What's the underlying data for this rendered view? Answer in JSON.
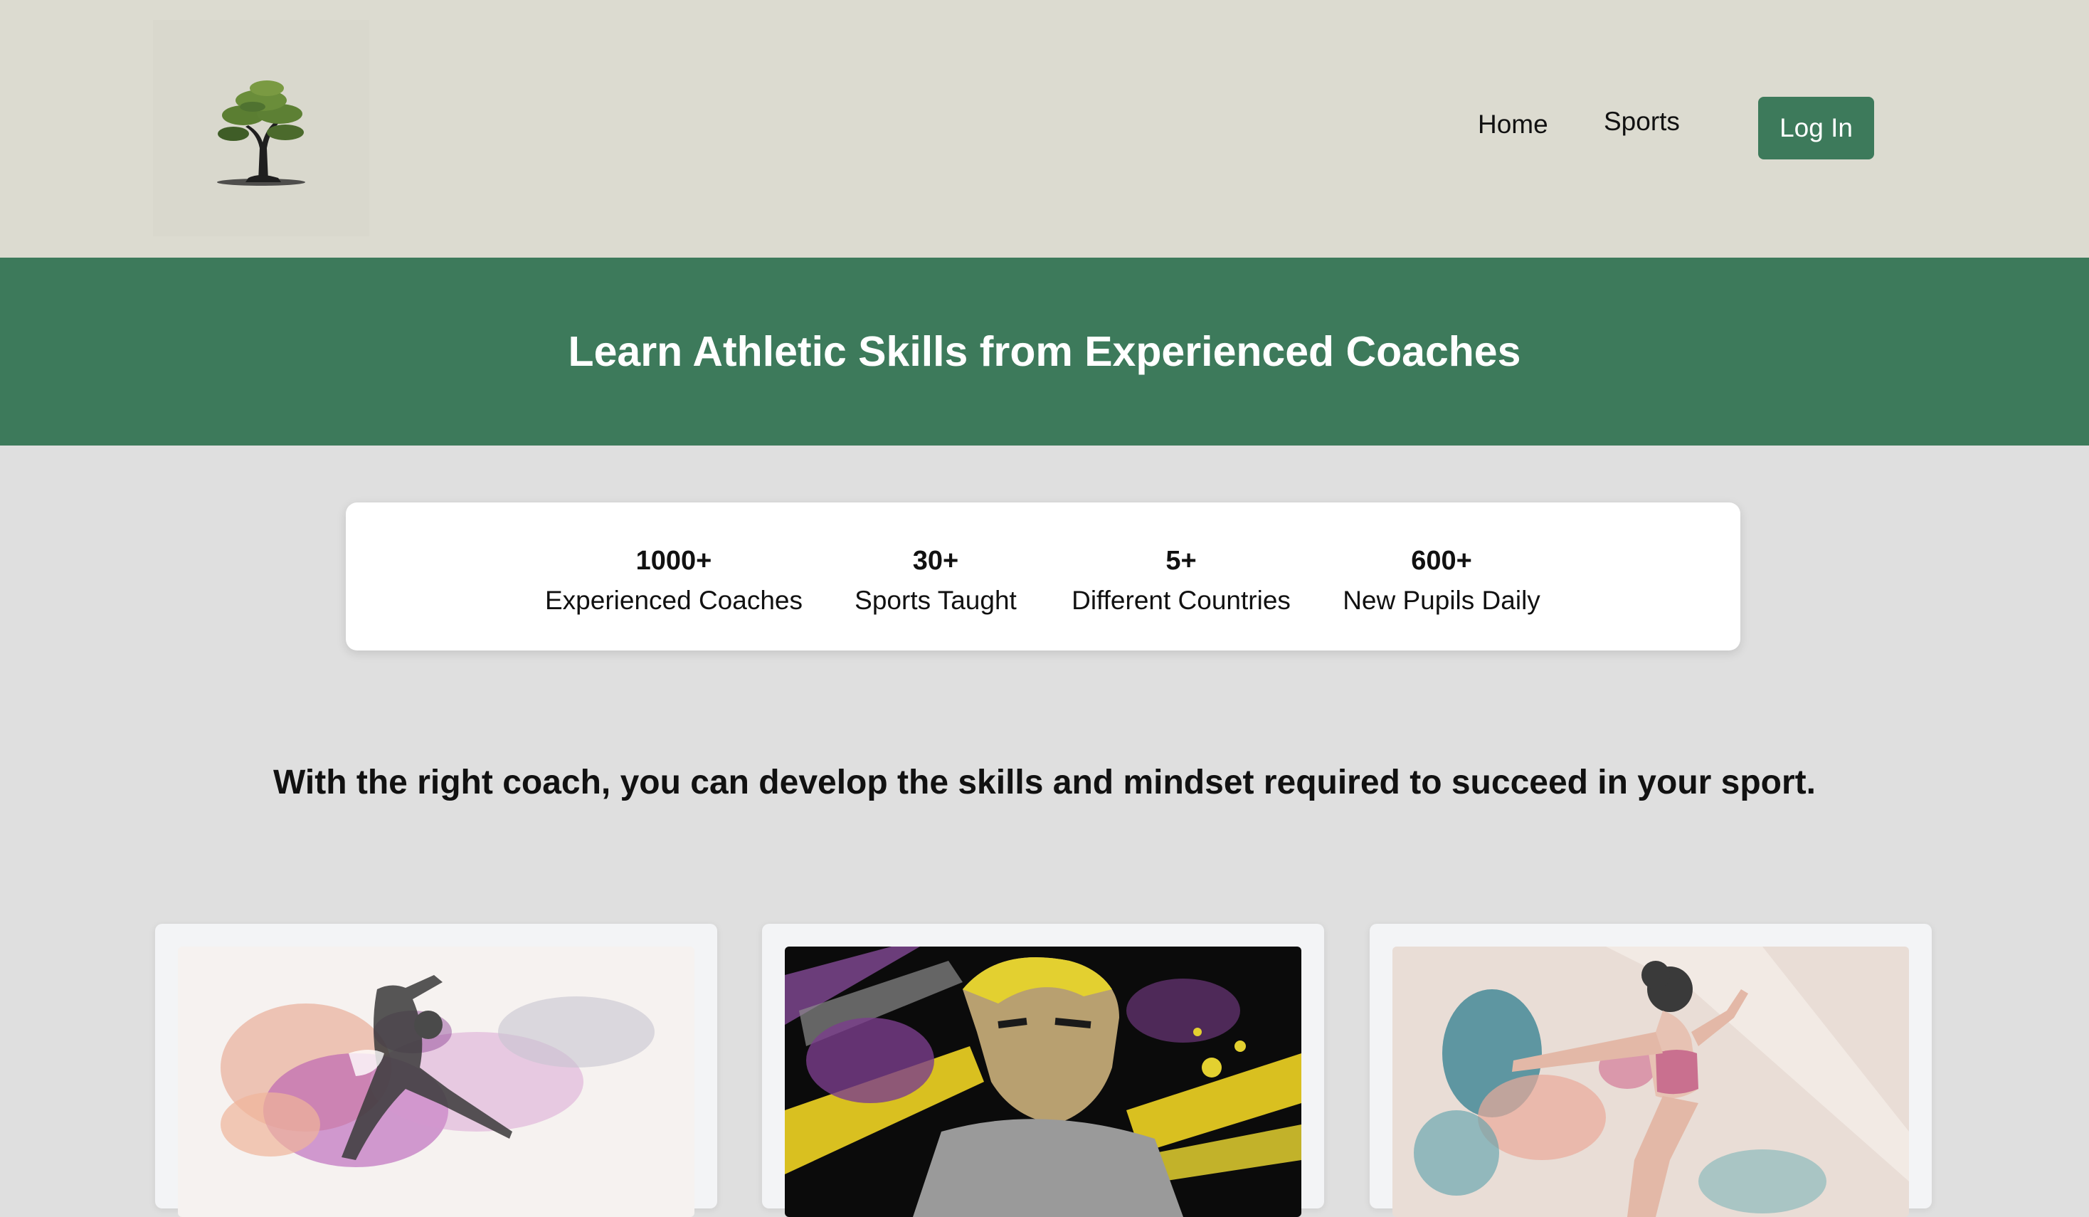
{
  "header": {
    "logo_icon": "tree-logo-icon",
    "nav": [
      {
        "label": "Home"
      },
      {
        "label": "Sports"
      }
    ],
    "login_label": "Log In"
  },
  "hero": {
    "title": "Learn Athletic Skills from Experienced Coaches"
  },
  "stats": [
    {
      "value": "1000+",
      "label": "Experienced Coaches"
    },
    {
      "value": "30+",
      "label": "Sports Taught"
    },
    {
      "value": "5+",
      "label": "Different Countries"
    },
    {
      "value": "600+",
      "label": "New Pupils Daily"
    }
  ],
  "tagline": "With the right coach, you can develop the skills and mindset required to succeed in your sport.",
  "cards": [
    {
      "image": "dancer-splash-art"
    },
    {
      "image": "fighter-splash-art"
    },
    {
      "image": "athlete-splash-art"
    }
  ],
  "colors": {
    "header_bg": "#dcdbd0",
    "brand_green": "#3d7a5b",
    "page_bg": "#dfdfdf",
    "card_bg": "#f3f4f6"
  }
}
